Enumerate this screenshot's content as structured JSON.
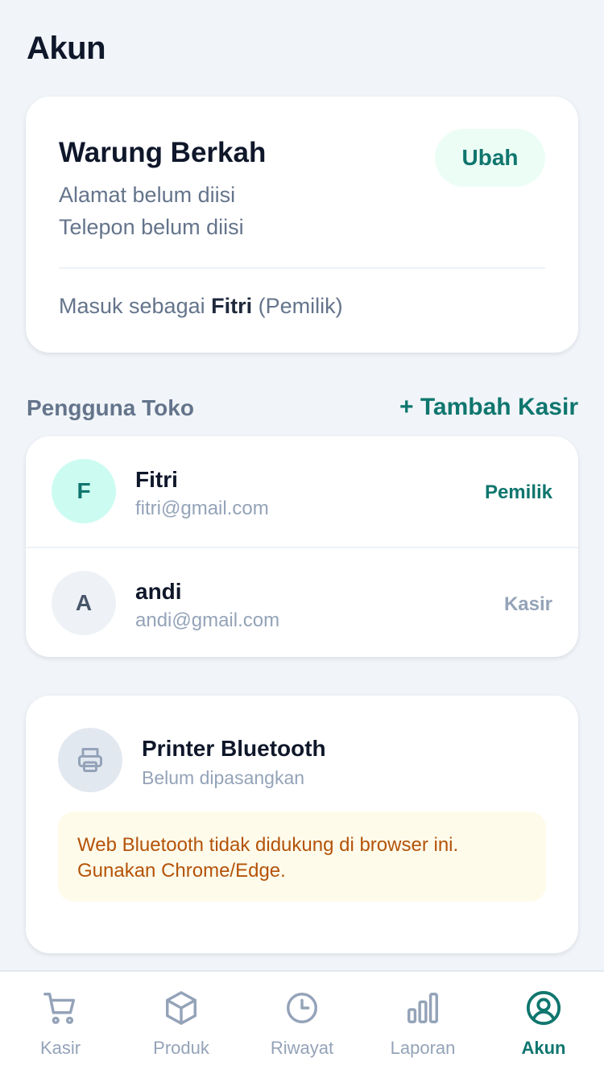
{
  "page": {
    "title": "Akun"
  },
  "store": {
    "name": "Warung Berkah",
    "address": "Alamat belum diisi",
    "phone": "Telepon belum diisi",
    "edit_label": "Ubah",
    "login_prefix": "Masuk sebagai",
    "login_user": "Fitri",
    "login_role": "(Pemilik)"
  },
  "users_section": {
    "title": "Pengguna Toko",
    "add_label": "+ Tambah Kasir",
    "users": [
      {
        "initial": "F",
        "name": "Fitri",
        "email": "fitri@gmail.com",
        "role": "Pemilik"
      },
      {
        "initial": "A",
        "name": "andi",
        "email": "andi@gmail.com",
        "role": "Kasir"
      }
    ]
  },
  "printer": {
    "icon": "printer-icon",
    "title": "Printer Bluetooth",
    "status": "Belum dipasangkan",
    "warning_line1": "Web Bluetooth tidak didukung di browser ini.",
    "warning_line2": "Gunakan Chrome/Edge."
  },
  "nav": {
    "items": [
      {
        "label": "Kasir",
        "icon": "cart-icon"
      },
      {
        "label": "Produk",
        "icon": "box-icon"
      },
      {
        "label": "Riwayat",
        "icon": "clock-icon"
      },
      {
        "label": "Laporan",
        "icon": "bar-chart-icon"
      },
      {
        "label": "Akun",
        "icon": "user-circle-icon"
      }
    ],
    "active": "Akun"
  },
  "colors": {
    "accent": "#0f766e",
    "accent_bg": "#ecfdf5",
    "background": "#f1f5f9",
    "warning_text": "#b45309",
    "warning_bg": "#fefbeb",
    "muted": "#94a3b8"
  }
}
